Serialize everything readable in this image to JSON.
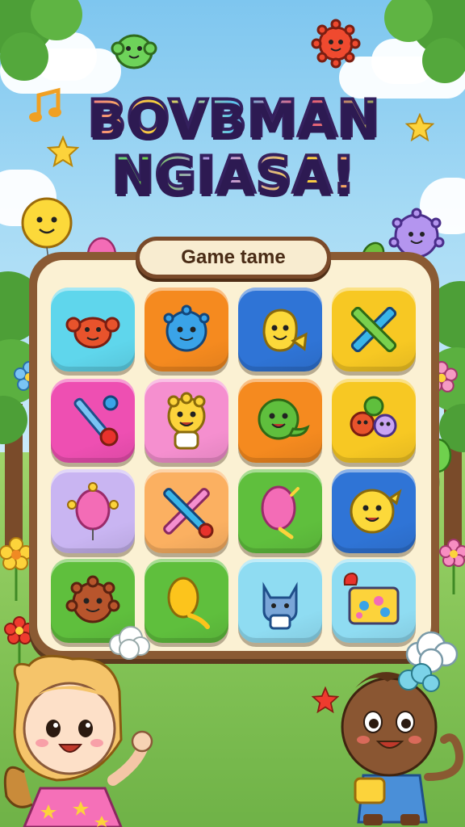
{
  "title": {
    "line1": "BOVBMAN",
    "line2": "NGIASA!"
  },
  "banner": {
    "label": "Game tame"
  },
  "colors": {
    "cyan": "#5fd6ec",
    "orange": "#f58a1f",
    "blue": "#2f74d6",
    "yellow": "#f7c823",
    "magenta": "#ee4fb2",
    "pink": "#f58fcf",
    "lavender": "#c9b5f2",
    "peach": "#fbb061",
    "green": "#5fbf3d",
    "lightblue": "#8fdcf2"
  },
  "tiles": [
    {
      "name": "tile-red-crab",
      "color": "cyan",
      "icon": "red-crab-icon"
    },
    {
      "name": "tile-blue-blob",
      "color": "orange",
      "icon": "blue-blob-icon"
    },
    {
      "name": "tile-yellow-fish",
      "color": "blue",
      "icon": "yellow-fish-icon"
    },
    {
      "name": "tile-crossed-pencils",
      "color": "yellow",
      "icon": "crossed-pencils-icon"
    },
    {
      "name": "tile-wand",
      "color": "magenta",
      "icon": "wand-icon"
    },
    {
      "name": "tile-yellow-monster",
      "color": "pink",
      "icon": "yellow-monster-icon"
    },
    {
      "name": "tile-green-dino",
      "color": "orange",
      "icon": "green-dino-icon"
    },
    {
      "name": "tile-monster-group",
      "color": "yellow",
      "icon": "monster-group-icon"
    },
    {
      "name": "tile-pink-balloon-face",
      "color": "lavender",
      "icon": "pink-balloon-icon"
    },
    {
      "name": "tile-crossed-sticks",
      "color": "peach",
      "icon": "crossed-sticks-icon"
    },
    {
      "name": "tile-pink-balloon",
      "color": "green",
      "icon": "balloon-icon"
    },
    {
      "name": "tile-yellow-blob",
      "color": "blue",
      "icon": "yellow-blob-icon"
    },
    {
      "name": "tile-brown-hedgehog",
      "color": "green",
      "icon": "hedgehog-icon"
    },
    {
      "name": "tile-yellow-balloon",
      "color": "green",
      "icon": "yellow-balloon-icon"
    },
    {
      "name": "tile-blue-cat",
      "color": "lightblue",
      "icon": "blue-cat-icon"
    },
    {
      "name": "tile-game-board",
      "color": "lightblue",
      "icon": "game-board-icon"
    }
  ]
}
